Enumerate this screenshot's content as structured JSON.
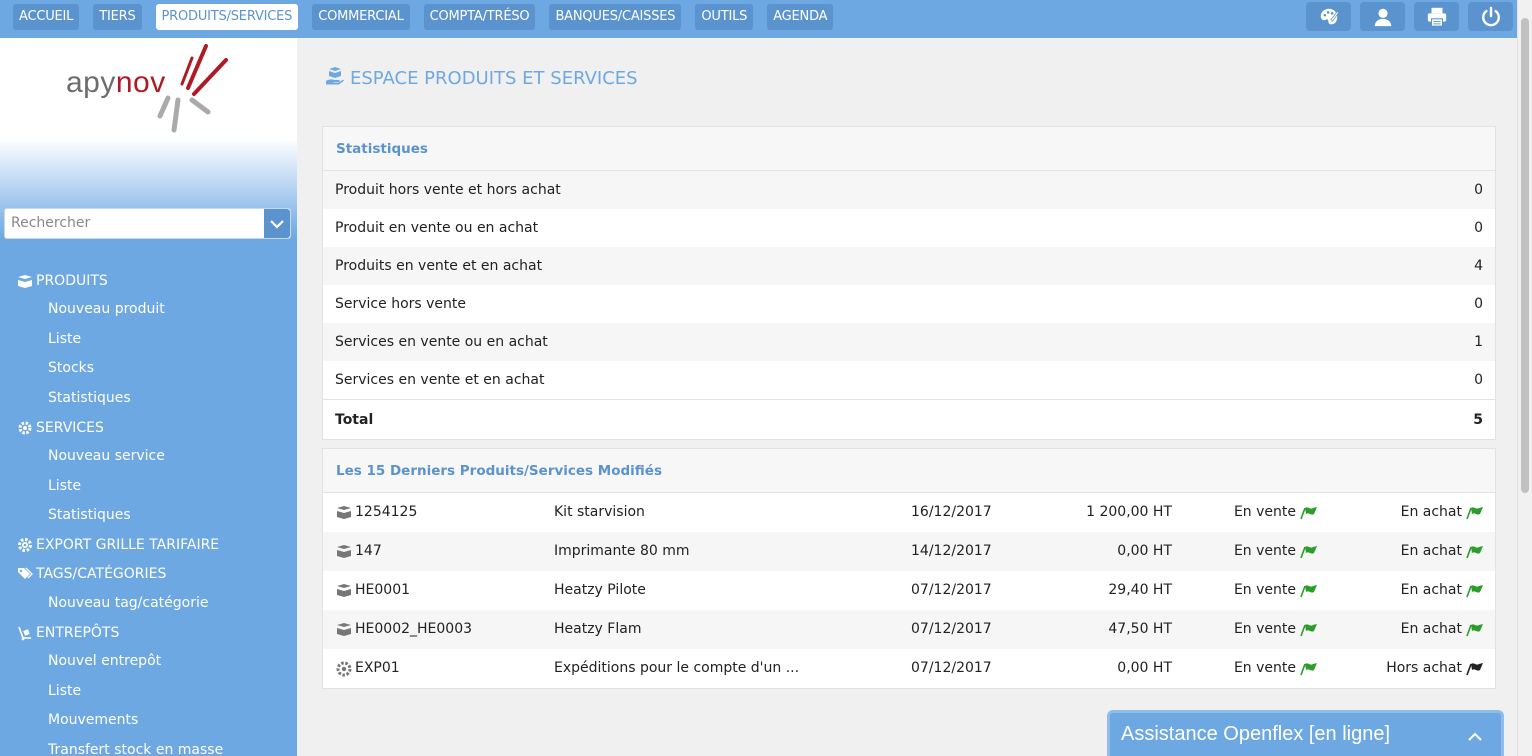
{
  "topnav": {
    "tabs": [
      {
        "label": "ACCUEIL",
        "active": false
      },
      {
        "label": "TIERS",
        "active": false
      },
      {
        "label": "PRODUITS/SERVICES",
        "active": true
      },
      {
        "label": "COMMERCIAL",
        "active": false
      },
      {
        "label": "COMPTA/TRÉSO",
        "active": false
      },
      {
        "label": "BANQUES/CAISSES",
        "active": false
      },
      {
        "label": "OUTILS",
        "active": false
      },
      {
        "label": "AGENDA",
        "active": false
      }
    ],
    "icons": [
      "palette-icon",
      "user-icon",
      "printer-icon",
      "power-icon"
    ]
  },
  "brand": {
    "logo_prefix": "apy",
    "logo_suffix": "nov",
    "accent": "#b01a24"
  },
  "sidebar": {
    "search_placeholder": "Rechercher",
    "sections": {
      "produits": {
        "title": "PRODUITS",
        "items": [
          "Nouveau produit",
          "Liste",
          "Stocks",
          "Statistiques"
        ]
      },
      "services": {
        "title": "SERVICES",
        "items": [
          "Nouveau service",
          "Liste",
          "Statistiques"
        ]
      },
      "export": {
        "title": "EXPORT GRILLE TARIFAIRE"
      },
      "tags": {
        "title": "TAGS/CATÉGORIES",
        "items": [
          "Nouveau tag/catégorie"
        ]
      },
      "entrepots": {
        "title": "ENTREPÔTS",
        "items": [
          "Nouvel entrepôt",
          "Liste",
          "Mouvements",
          "Transfert stock en masse"
        ]
      }
    }
  },
  "main": {
    "title": "ESPACE PRODUITS ET SERVICES",
    "stats": {
      "header": "Statistiques",
      "rows": [
        {
          "label": "Produit hors vente et hors achat",
          "value": "0"
        },
        {
          "label": "Produit en vente ou en achat",
          "value": "0"
        },
        {
          "label": "Produits en vente et en achat",
          "value": "4"
        },
        {
          "label": "Service hors vente",
          "value": "0"
        },
        {
          "label": "Services en vente ou en achat",
          "value": "1"
        },
        {
          "label": "Services en vente et en achat",
          "value": "0"
        }
      ],
      "total_label": "Total",
      "total_value": "5"
    },
    "latest": {
      "header": "Les 15 Derniers Produits/Services Modifiés",
      "rows": [
        {
          "type": "product",
          "ref": "1254125",
          "label": "Kit starvision",
          "date": "16/12/2017",
          "price": "1 200,00 HT",
          "sell": "En vente",
          "buy": "En achat",
          "buy_on": true
        },
        {
          "type": "product",
          "ref": "147",
          "label": "Imprimante 80 mm",
          "date": "14/12/2017",
          "price": "0,00 HT",
          "sell": "En vente",
          "buy": "En achat",
          "buy_on": true
        },
        {
          "type": "product",
          "ref": "HE0001",
          "label": "Heatzy Pilote",
          "date": "07/12/2017",
          "price": "29,40 HT",
          "sell": "En vente",
          "buy": "En achat",
          "buy_on": true
        },
        {
          "type": "product",
          "ref": "HE0002_HE0003",
          "label": "Heatzy Flam",
          "date": "07/12/2017",
          "price": "47,50 HT",
          "sell": "En vente",
          "buy": "En achat",
          "buy_on": true
        },
        {
          "type": "service",
          "ref": "EXP01",
          "label": "Expéditions pour le compte d'un ...",
          "date": "07/12/2017",
          "price": "0,00 HT",
          "sell": "En vente",
          "buy": "Hors achat",
          "buy_on": false
        }
      ]
    }
  },
  "chat": {
    "label": "Assistance Openflex [en ligne]"
  },
  "colors": {
    "primary": "#6ea8e3",
    "primary_dark": "#5b93cf",
    "status_on": "#2a9d2a",
    "status_off": "#222222"
  }
}
